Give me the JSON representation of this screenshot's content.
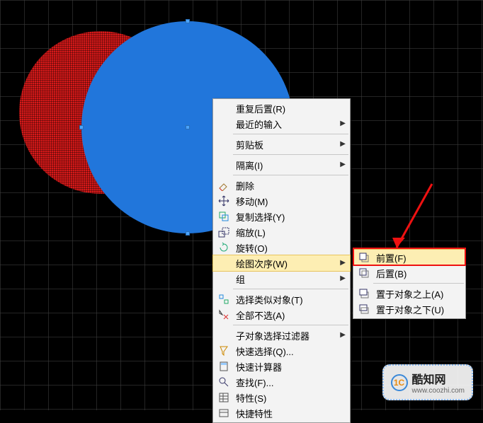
{
  "canvas": {
    "red_circle": "red-hatched-circle",
    "blue_circle": "blue-solid-circle"
  },
  "context_menu": {
    "items": [
      {
        "label": "重复后置(R)",
        "icon": null,
        "submenu": false
      },
      {
        "label": "最近的输入",
        "icon": null,
        "submenu": true
      },
      "sep",
      {
        "label": "剪贴板",
        "icon": null,
        "submenu": true
      },
      "sep",
      {
        "label": "隔离(I)",
        "icon": null,
        "submenu": true
      },
      "sep",
      {
        "label": "删除",
        "icon": "erase",
        "submenu": false
      },
      {
        "label": "移动(M)",
        "icon": "move",
        "submenu": false
      },
      {
        "label": "复制选择(Y)",
        "icon": "copy",
        "submenu": false
      },
      {
        "label": "缩放(L)",
        "icon": "scale",
        "submenu": false
      },
      {
        "label": "旋转(O)",
        "icon": "rotate",
        "submenu": false
      },
      {
        "label": "绘图次序(W)",
        "icon": null,
        "submenu": true,
        "highlight": true
      },
      {
        "label": "组",
        "icon": null,
        "submenu": true
      },
      "sep",
      {
        "label": "选择类似对象(T)",
        "icon": "select-similar",
        "submenu": false
      },
      {
        "label": "全部不选(A)",
        "icon": "deselect",
        "submenu": false
      },
      "sep",
      {
        "label": "子对象选择过滤器",
        "icon": null,
        "submenu": true
      },
      {
        "label": "快速选择(Q)...",
        "icon": "quick-select",
        "submenu": false
      },
      {
        "label": "快速计算器",
        "icon": "calc",
        "submenu": false
      },
      {
        "label": "查找(F)...",
        "icon": "find",
        "submenu": false
      },
      {
        "label": "特性(S)",
        "icon": "props",
        "submenu": false
      },
      {
        "label": "快捷特性",
        "icon": "qprops",
        "submenu": false
      }
    ]
  },
  "draw_order_submenu": {
    "items": [
      {
        "label": "前置(F)",
        "icon": "bring-front",
        "highlight": true
      },
      {
        "label": "后置(B)",
        "icon": "send-back"
      },
      "sep",
      {
        "label": "置于对象之上(A)",
        "icon": "above-obj"
      },
      {
        "label": "置于对象之下(U)",
        "icon": "below-obj"
      }
    ]
  },
  "watermark": {
    "logo": "1C",
    "title": "酷知网",
    "url": "www.coozhi.com"
  }
}
